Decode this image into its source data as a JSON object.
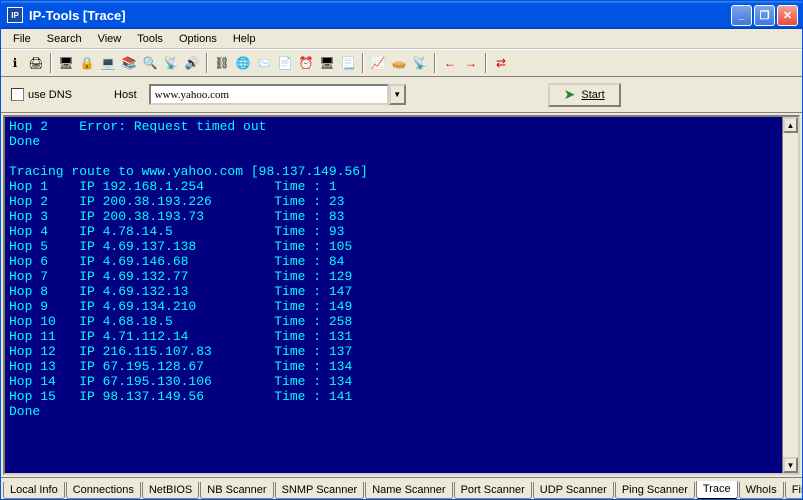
{
  "window": {
    "title": "IP-Tools [Trace]"
  },
  "menu": {
    "items": [
      "File",
      "Search",
      "View",
      "Tools",
      "Options",
      "Help"
    ]
  },
  "toolbar": {
    "groups": [
      [
        "ℹ",
        "🖨"
      ],
      [
        "🖥",
        "🔒",
        "💻",
        "📚",
        "🔍",
        "📡",
        "🔊"
      ],
      [
        "⛓",
        "🌐",
        "📨",
        "📄",
        "⏰",
        "🖥",
        "📃"
      ],
      [
        "📈",
        "🥧",
        "📡"
      ],
      [
        "←",
        "→"
      ],
      [
        "⇄"
      ]
    ]
  },
  "controls": {
    "use_dns_label": "use DNS",
    "host_label": "Host",
    "host_value": "www.yahoo.com",
    "start_label": "Start"
  },
  "trace": {
    "pre_lines": [
      "Hop 2    Error: Request timed out",
      "Done",
      "",
      "Tracing route to www.yahoo.com [98.137.149.56]"
    ],
    "hops": [
      {
        "n": 1,
        "ip": "192.168.1.254",
        "time": "1"
      },
      {
        "n": 2,
        "ip": "200.38.193.226",
        "time": "23"
      },
      {
        "n": 3,
        "ip": "200.38.193.73",
        "time": "83"
      },
      {
        "n": 4,
        "ip": "4.78.14.5",
        "time": "93"
      },
      {
        "n": 5,
        "ip": "4.69.137.138",
        "time": "105"
      },
      {
        "n": 6,
        "ip": "4.69.146.68",
        "time": "84"
      },
      {
        "n": 7,
        "ip": "4.69.132.77",
        "time": "129"
      },
      {
        "n": 8,
        "ip": "4.69.132.13",
        "time": "147"
      },
      {
        "n": 9,
        "ip": "4.69.134.210",
        "time": "149"
      },
      {
        "n": 10,
        "ip": "4.68.18.5",
        "time": "258"
      },
      {
        "n": 11,
        "ip": "4.71.112.14",
        "time": "131"
      },
      {
        "n": 12,
        "ip": "216.115.107.83",
        "time": "137"
      },
      {
        "n": 13,
        "ip": "67.195.128.67",
        "time": "134"
      },
      {
        "n": 14,
        "ip": "67.195.130.106",
        "time": "134"
      },
      {
        "n": 15,
        "ip": "98.137.149.56",
        "time": "141"
      }
    ],
    "post_lines": [
      "Done"
    ]
  },
  "tabs": {
    "items": [
      "Local Info",
      "Connections",
      "NetBIOS",
      "NB Scanner",
      "SNMP Scanner",
      "Name Scanner",
      "Port Scanner",
      "UDP Scanner",
      "Ping Scanner",
      "Trace",
      "WhoIs",
      "Fing"
    ],
    "active": "Trace"
  }
}
